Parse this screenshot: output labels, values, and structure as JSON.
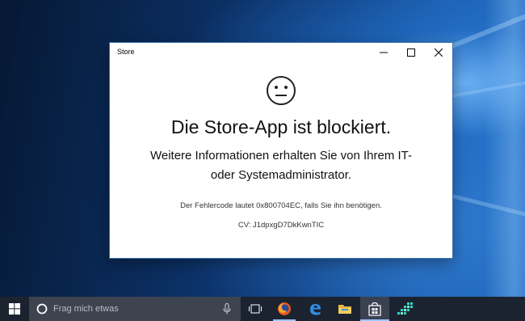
{
  "window": {
    "title": "Store",
    "controls": {
      "minimize_icon": "minimize-icon",
      "maximize_icon": "maximize-icon",
      "close_icon": "close-icon"
    }
  },
  "dialog": {
    "icon": "sad-face-icon",
    "heading": "Die Store-App ist blockiert.",
    "subtext_line1": "Weitere Informationen erhalten Sie von Ihrem IT-",
    "subtext_line2": "oder Systemadministrator.",
    "error_code_text": "Der Fehlercode lautet 0x800704EC, falls Sie ihn benötigen.",
    "cv_text": "CV: J1dpxgD7DkKwnTIC"
  },
  "taskbar": {
    "search": {
      "placeholder": "Frag mich etwas"
    },
    "items": [
      {
        "name": "task-view-icon"
      },
      {
        "name": "firefox-icon"
      },
      {
        "name": "edge-icon"
      },
      {
        "name": "file-explorer-icon"
      },
      {
        "name": "store-icon",
        "active": true
      },
      {
        "name": "pixel-app-icon"
      }
    ]
  },
  "colors": {
    "taskbar_bg": "#1c2330",
    "search_bg": "#3d4450",
    "accent": "#9cc3ff",
    "window_bg": "#ffffff"
  }
}
